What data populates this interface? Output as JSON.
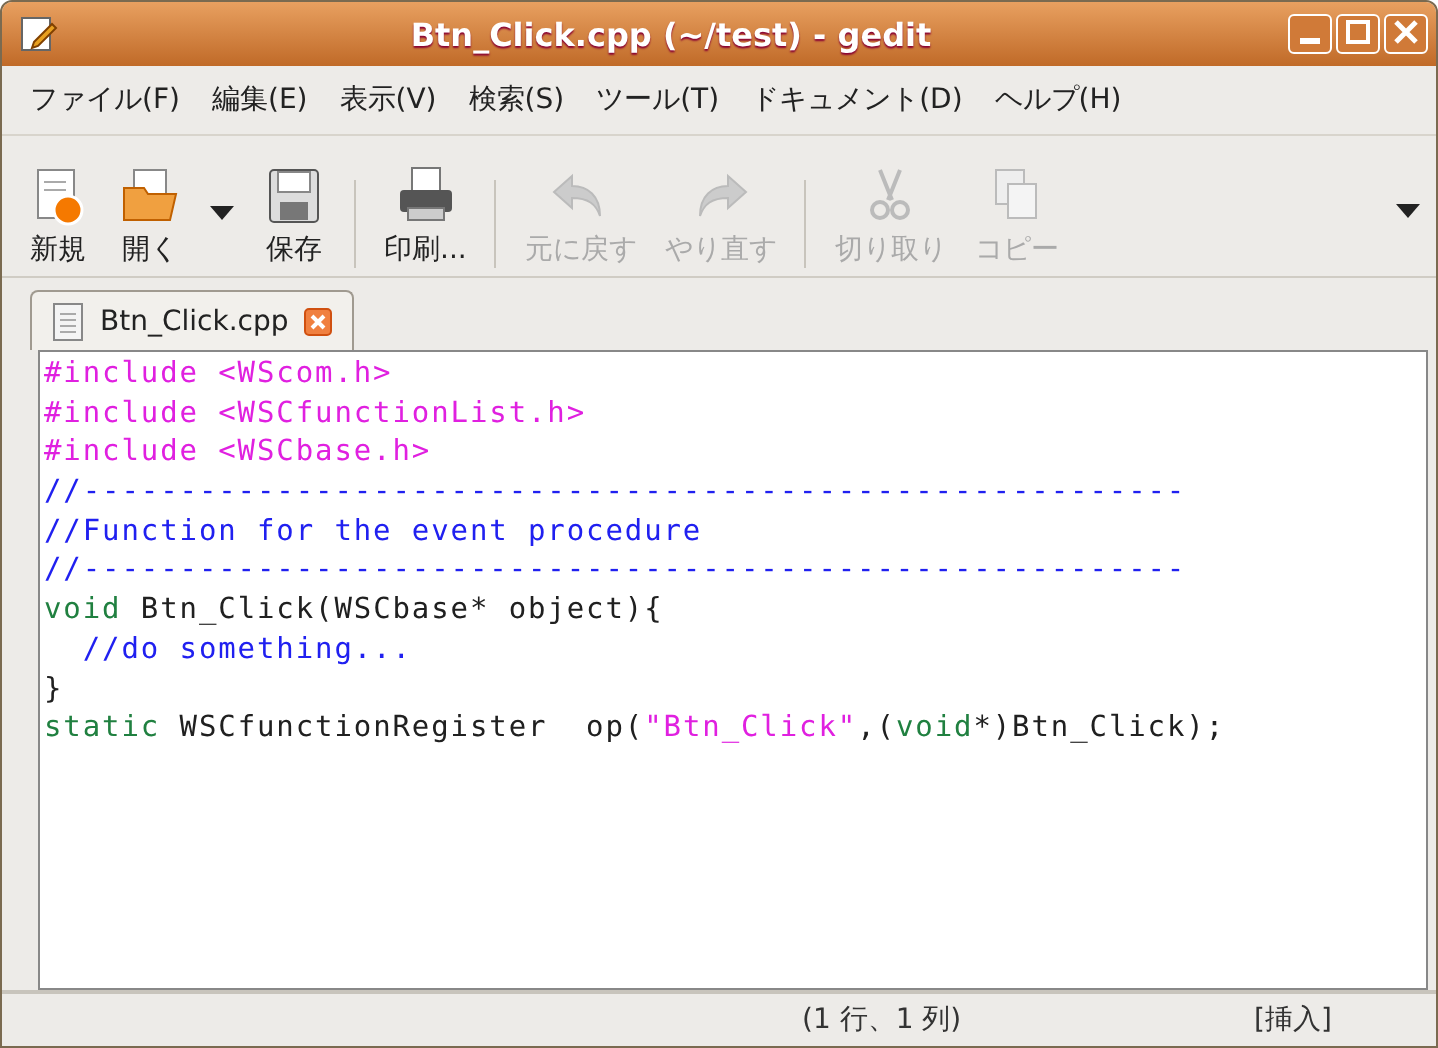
{
  "window": {
    "title": "Btn_Click.cpp (~/test) - gedit"
  },
  "menu": [
    "ファイル(F)",
    "編集(E)",
    "表示(V)",
    "検索(S)",
    "ツール(T)",
    "ドキュメント(D)",
    "ヘルプ(H)"
  ],
  "toolbar": [
    {
      "kind": "new",
      "label": "新規",
      "disabled": false
    },
    {
      "kind": "open",
      "label": "開く",
      "disabled": false
    },
    {
      "kind": "dropdown",
      "disabled": false
    },
    {
      "kind": "save",
      "label": "保存",
      "disabled": false
    },
    {
      "kind": "separator"
    },
    {
      "kind": "print",
      "label": "印刷...",
      "disabled": false
    },
    {
      "kind": "separator"
    },
    {
      "kind": "undo",
      "label": "元に戻す",
      "disabled": true
    },
    {
      "kind": "redo",
      "label": "やり直す",
      "disabled": true
    },
    {
      "kind": "separator"
    },
    {
      "kind": "cut",
      "label": "切り取り",
      "disabled": true
    },
    {
      "kind": "copy",
      "label": "コピー",
      "disabled": true
    }
  ],
  "tabs": [
    {
      "label": "Btn_Click.cpp",
      "selected": true
    }
  ],
  "code": [
    [
      {
        "kind": "preproc",
        "text": "#include <WScom.h>"
      }
    ],
    [
      {
        "kind": "preproc",
        "text": "#include <WSCfunctionList.h>"
      }
    ],
    [
      {
        "kind": "preproc",
        "text": "#include <WSCbase.h>"
      }
    ],
    [
      {
        "kind": "comment",
        "text": "//---------------------------------------------------------"
      }
    ],
    [
      {
        "kind": "comment",
        "text": "//Function for the event procedure"
      }
    ],
    [
      {
        "kind": "comment",
        "text": "//---------------------------------------------------------"
      }
    ],
    [
      {
        "kind": "keyword",
        "text": "void"
      },
      {
        "kind": "plain",
        "text": " Btn_Click(WSCbase* object){"
      }
    ],
    [
      {
        "kind": "comment",
        "text": "  //do something..."
      }
    ],
    [
      {
        "kind": "plain",
        "text": "}"
      }
    ],
    [
      {
        "kind": "keyword",
        "text": "static"
      },
      {
        "kind": "plain",
        "text": " WSCfunctionRegister  op("
      },
      {
        "kind": "string",
        "text": "\"Btn_Click\""
      },
      {
        "kind": "plain",
        "text": ",("
      },
      {
        "kind": "keyword",
        "text": "void"
      },
      {
        "kind": "plain",
        "text": "*)Btn_Click);"
      }
    ]
  ],
  "status_bar": {
    "position": "(1 行、1 列)",
    "mode": "[挿入]"
  }
}
